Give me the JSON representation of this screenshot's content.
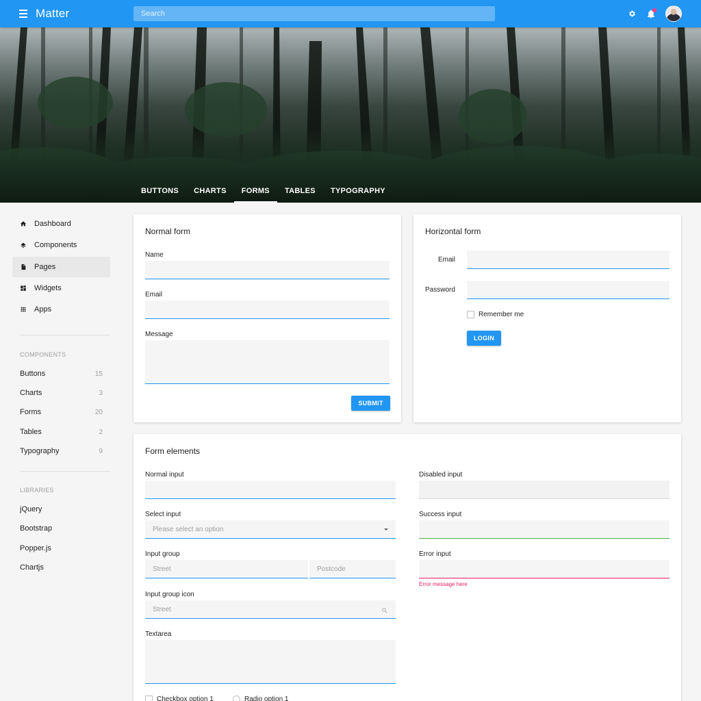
{
  "appbar": {
    "title": "Matter",
    "search_placeholder": "Search",
    "colors": {
      "primary": "#2196f3",
      "search_bg": "#64b5f6",
      "notification": "#ff4081"
    },
    "icons": [
      "menu-icon",
      "settings-icon",
      "notifications-icon"
    ]
  },
  "hero": {
    "tabs": [
      {
        "label": "Buttons",
        "active": false
      },
      {
        "label": "Charts",
        "active": false
      },
      {
        "label": "Forms",
        "active": true
      },
      {
        "label": "Tables",
        "active": false
      },
      {
        "label": "Typography",
        "active": false
      }
    ]
  },
  "sidebar": {
    "nav": [
      {
        "label": "Dashboard",
        "icon": "home-icon",
        "active": false
      },
      {
        "label": "Components",
        "icon": "layers-icon",
        "active": false
      },
      {
        "label": "Pages",
        "icon": "file-icon",
        "active": true
      },
      {
        "label": "Widgets",
        "icon": "widgets-icon",
        "active": false
      },
      {
        "label": "Apps",
        "icon": "apps-grid-icon",
        "active": false
      }
    ],
    "components_label": "Components",
    "components": [
      {
        "label": "Buttons",
        "count": "15"
      },
      {
        "label": "Charts",
        "count": "3"
      },
      {
        "label": "Forms",
        "count": "20"
      },
      {
        "label": "Tables",
        "count": "2"
      },
      {
        "label": "Typography",
        "count": "9"
      }
    ],
    "libraries_label": "Libraries",
    "libraries": [
      {
        "label": "jQuery"
      },
      {
        "label": "Bootstrap"
      },
      {
        "label": "Popper.js"
      },
      {
        "label": "Chartjs"
      }
    ]
  },
  "normal_form": {
    "title": "Normal form",
    "name_label": "Name",
    "email_label": "Email",
    "message_label": "Message",
    "submit_label": "Submit"
  },
  "horizontal_form": {
    "title": "Horizontal form",
    "email_label": "Email",
    "password_label": "Password",
    "remember_label": "Remember me",
    "login_label": "Login"
  },
  "form_elements": {
    "title": "Form elements",
    "normal_label": "Normal input",
    "select_label": "Select input",
    "select_placeholder": "Please select an option",
    "group_label": "Input group",
    "group_street": "Street",
    "group_postcode": "Postcode",
    "group_icon_label": "Input group icon",
    "group_icon_street": "Street",
    "textarea_label": "Textarea",
    "disabled_label": "Disabled input",
    "success_label": "Success input",
    "error_label": "Error input",
    "error_message": "Error message here",
    "checkbox_label": "Checkbox option 1",
    "radio_label": "Radio option 1",
    "colors": {
      "success": "#4caf50",
      "error": "#e91e63"
    }
  }
}
